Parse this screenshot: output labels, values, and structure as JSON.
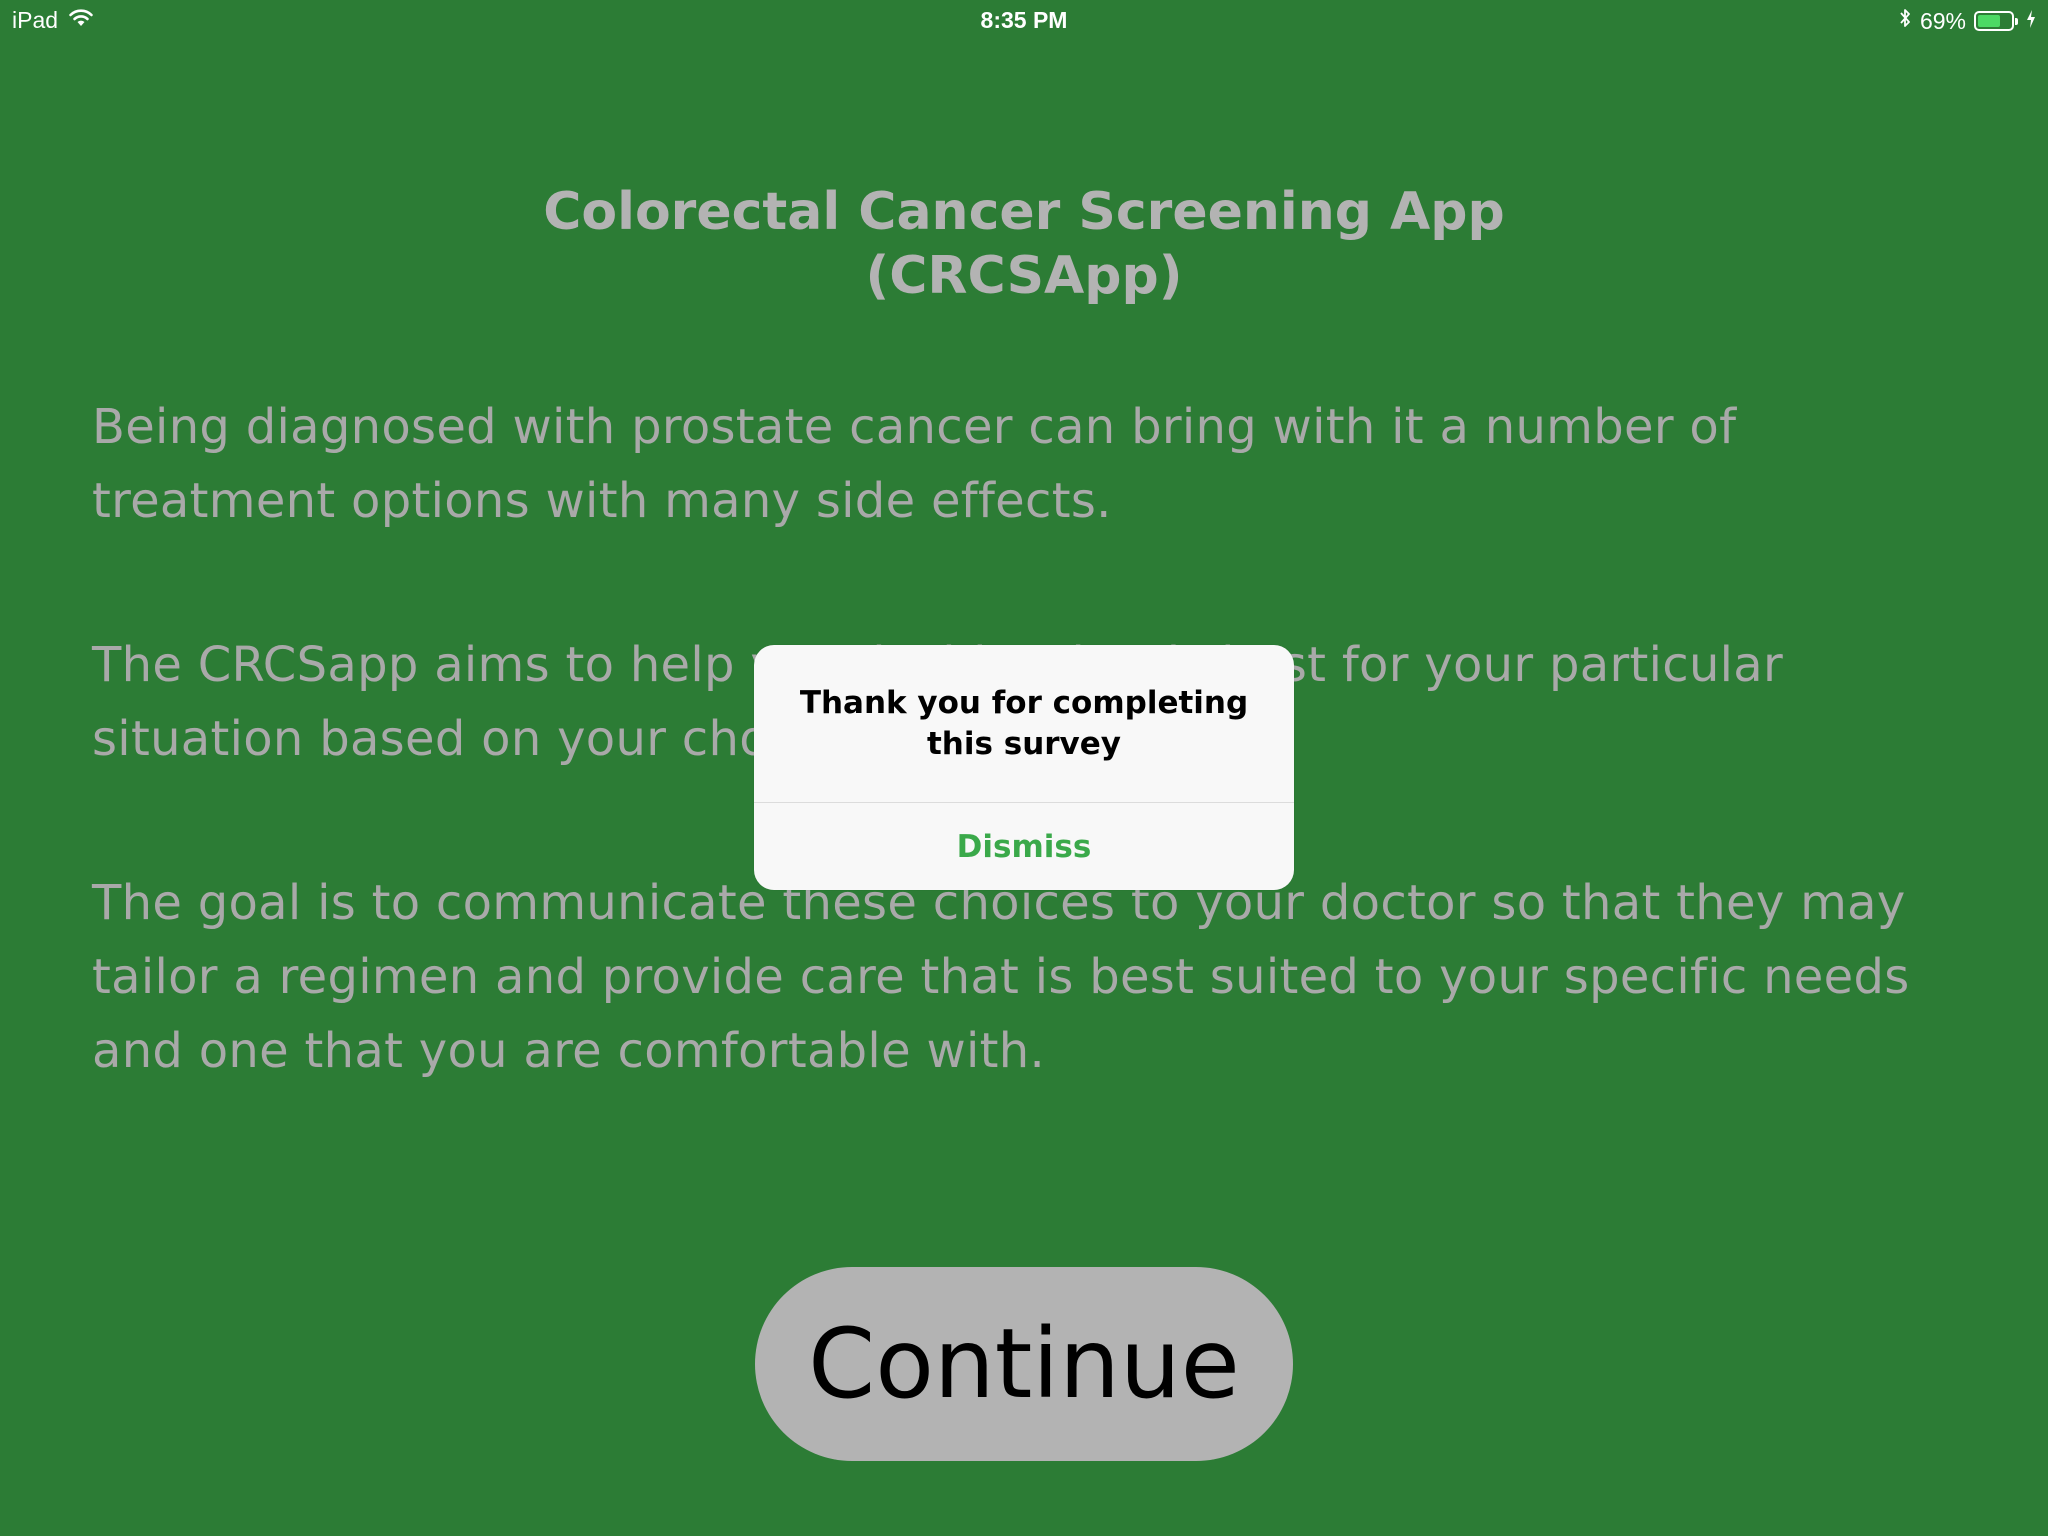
{
  "status_bar": {
    "device": "iPad",
    "time": "8:35 PM",
    "battery_percent": "69%",
    "battery_level": 0.69,
    "icons": [
      "wifi-icon",
      "bluetooth-icon",
      "battery-icon",
      "charging-icon"
    ]
  },
  "main": {
    "title_line1": "Colorectal Cancer Screening App",
    "title_line2": "(CRCSApp)",
    "paragraph1": "Being diagnosed with prostate cancer can bring with it a number of treatment options with many side effects.",
    "paragraph2": "The CRCSapp aims to help you decide what is best for your particular situation based on your choices.",
    "paragraph3": "The goal is to communicate these choices to your doctor so that they may tailor a regimen and provide care that is best suited to your specific needs and one that you are comfortable with.",
    "continue_label": "Continue"
  },
  "alert": {
    "message": "Thank you for completing this survey",
    "dismiss_label": "Dismiss"
  },
  "colors": {
    "background": "#2c7c35",
    "text_gray": "#a9a9a9",
    "button_gray": "#b3b3b3",
    "alert_accent": "#3aa94a",
    "battery_green": "#4cd964"
  }
}
